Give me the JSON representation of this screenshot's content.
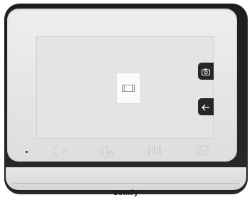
{
  "brand": {
    "logo_text": "somfy"
  },
  "screen": {
    "center_tile": {
      "icon": "gate-icon"
    }
  },
  "side_buttons": [
    {
      "icon": "camera-icon"
    },
    {
      "icon": "back-arrow-icon"
    }
  ],
  "bottom_bar": {
    "status_led": "led-indicator",
    "icons": [
      "intercom-speaker-icon",
      "door-lock-icon",
      "gate-icon",
      "photo-gallery-icon"
    ]
  },
  "colors": {
    "bezel_frame": "#222222",
    "screen_background": "#e4e4e4",
    "button_dark": "#262626",
    "icon_light": "#cfcfcf"
  }
}
